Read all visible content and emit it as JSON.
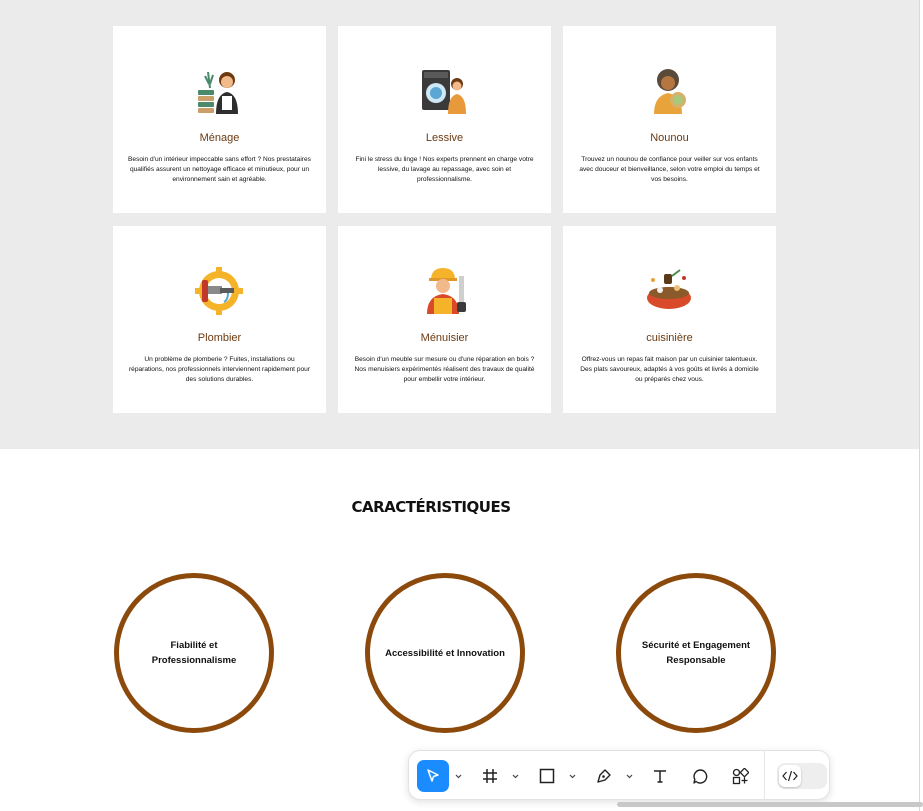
{
  "services": [
    {
      "title": "Ménage",
      "description": "Besoin d'un intérieur impeccable sans effort ? Nos prestataires qualifiés assurent un nettoyage efficace et minutieux, pour un environnement sain et agréable.",
      "icon": "cleaning-lady-icon"
    },
    {
      "title": "Lessive",
      "description": "Fini le stress du linge ! Nos experts prennent en charge votre lessive, du lavage au repassage, avec soin et professionnalisme.",
      "icon": "laundry-icon"
    },
    {
      "title": "Nounou",
      "description": "Trouvez un nounou de confiance pour veiller sur vos enfants avec douceur et bienveillance, selon votre emploi du temps et vos besoins.",
      "icon": "nanny-icon"
    },
    {
      "title": "Plombier",
      "description": "Un problème de plomberie ? Fuites, installations ou réparations, nos professionnels interviennent rapidement pour des solutions durables.",
      "icon": "plumber-icon"
    },
    {
      "title": "Ménuisier",
      "description": "Besoin d'un meuble sur mesure ou d'une réparation en bois ? Nos menuisiers expérimentés réalisent des travaux de qualité pour embellir votre intérieur.",
      "icon": "carpenter-icon"
    },
    {
      "title": "cuisinière",
      "description": "Offrez-vous un repas fait maison par un cuisinier talentueux. Des plats savoureux, adaptés à vos goûts et livrés à domicile ou préparés chez vous.",
      "icon": "cooking-pot-icon"
    }
  ],
  "features": {
    "title": "CARACTÉRISTIQUES",
    "items": [
      "Fiabilité et Professionnalisme",
      "Accessibilité et Innovation",
      "Sécurité et Engagement Responsable"
    ]
  },
  "toolbar": {
    "tools": [
      "move-tool",
      "frame-tool",
      "shape-tool",
      "pen-tool",
      "text-tool",
      "comment-tool",
      "actions-tool",
      "dev-mode-toggle"
    ],
    "active": "move-tool",
    "accent": "#1a8cff"
  },
  "colors": {
    "title_brown": "#6b3a12",
    "circle_border": "#8b4a0c",
    "background_gray": "#ebebeb"
  }
}
